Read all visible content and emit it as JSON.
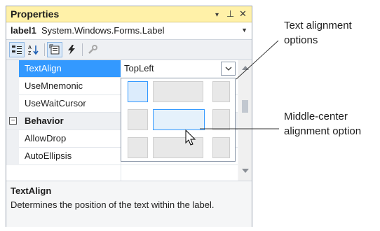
{
  "panel": {
    "title": "Properties",
    "controls": {
      "dropdown": "▾",
      "pin": "⊥",
      "close": "✕"
    }
  },
  "object": {
    "name": "label1",
    "type": "System.Windows.Forms.Label",
    "dropdown_arrow": "▼"
  },
  "toolbar": {
    "buttons": [
      {
        "icon": "categorized-icon",
        "active": true
      },
      {
        "icon": "alphabetical-sort-icon",
        "active": false
      },
      {
        "icon": "properties-icon",
        "active": true
      },
      {
        "icon": "events-lightning-icon",
        "active": false
      },
      {
        "icon": "property-pages-wrench-icon",
        "active": false
      }
    ]
  },
  "grid": {
    "rows": [
      {
        "label": "TextAlign",
        "value": "TopLeft",
        "selected": true
      },
      {
        "label": "UseMnemonic"
      },
      {
        "label": "UseWaitCursor"
      },
      {
        "label": "Behavior",
        "category": true,
        "toggle": "⊟"
      },
      {
        "label": "AllowDrop"
      },
      {
        "label": "AutoEllipsis"
      }
    ]
  },
  "alignment_picker": {
    "options": [
      "TopLeft",
      "TopCenter",
      "TopRight",
      "MiddleLeft",
      "MiddleCenter",
      "MiddleRight",
      "BottomLeft",
      "BottomCenter",
      "BottomRight"
    ],
    "current": "TopLeft",
    "hovered": "MiddleCenter"
  },
  "description": {
    "title": "TextAlign",
    "text": "Determines the position of the text within the label."
  },
  "callouts": {
    "text_alignment": [
      "Text alignment",
      "options"
    ],
    "middle_center": [
      "Middle-center",
      "alignment option"
    ]
  },
  "colors": {
    "title_bar": "#fff1a8",
    "selection": "#3399ff",
    "highlight_border": "#3399ff"
  }
}
